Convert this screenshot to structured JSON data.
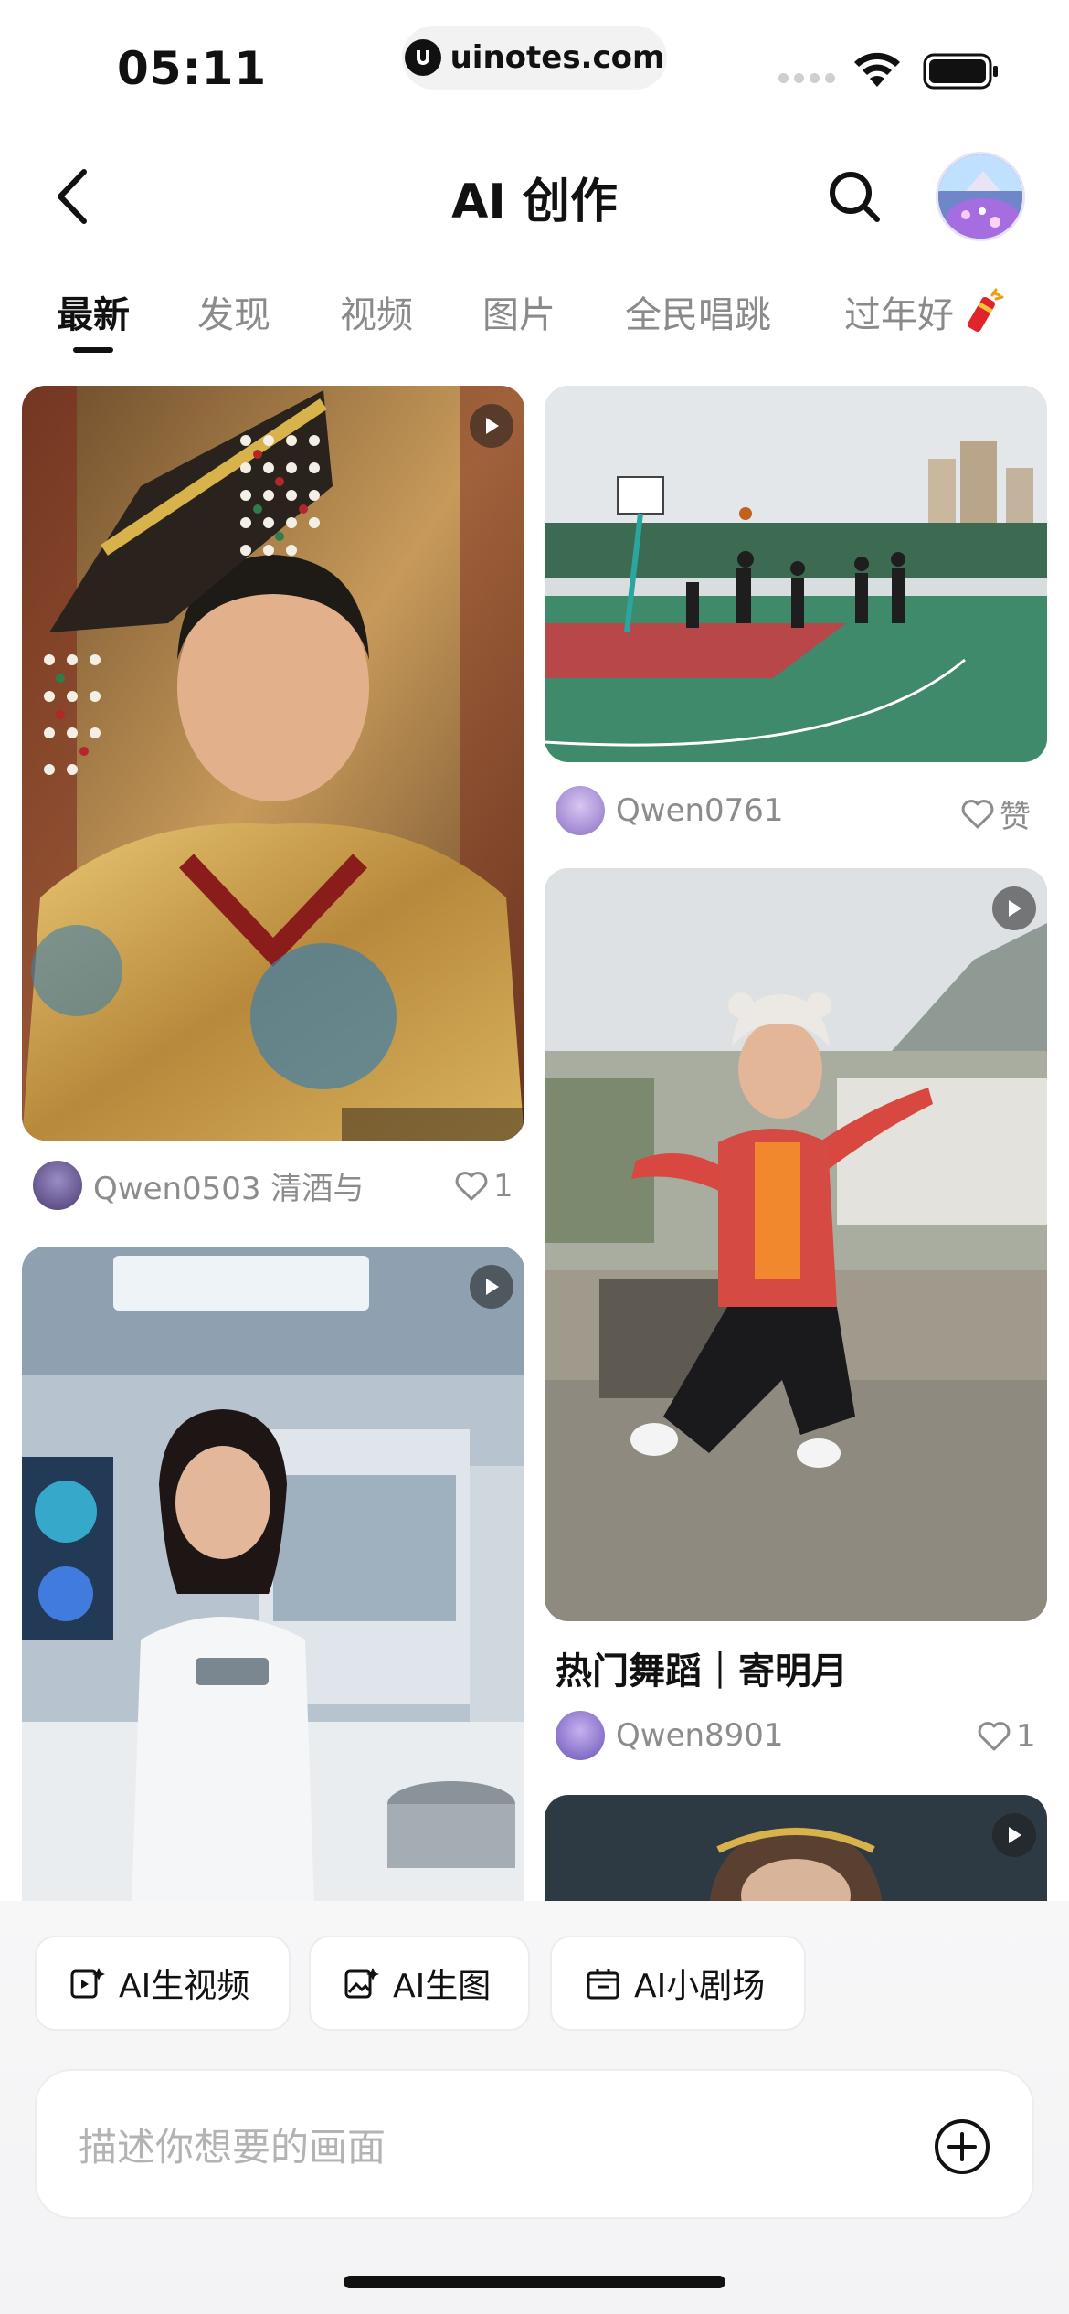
{
  "status_bar": {
    "time": "05:11",
    "url": "uinotes.com"
  },
  "header": {
    "title": "AI 创作"
  },
  "tabs": [
    {
      "label": "最新",
      "active": true
    },
    {
      "label": "发现"
    },
    {
      "label": "视频"
    },
    {
      "label": "图片"
    },
    {
      "label": "全民唱跳"
    },
    {
      "label": "过年好"
    }
  ],
  "cards": {
    "emperor": {
      "user": "Qwen0503 清酒与",
      "likes": "1"
    },
    "basketball": {
      "user": "Qwen0761",
      "likes": "赞"
    },
    "dance": {
      "title": "热门舞蹈｜寄明月",
      "user": "Qwen8901",
      "likes": "1"
    }
  },
  "bottom": {
    "quick_actions": [
      "AI生视频",
      "AI生图",
      "AI小剧场"
    ],
    "prompt_placeholder": "描述你想要的画面"
  },
  "colors": {
    "accent": "#111111",
    "muted": "#8c8c8c",
    "panel": "#f5f5f7"
  }
}
